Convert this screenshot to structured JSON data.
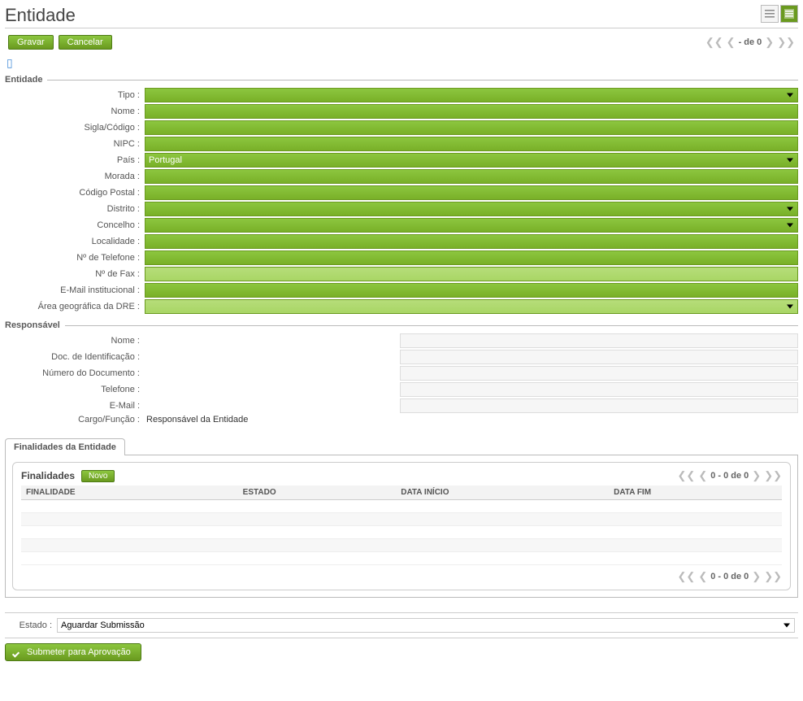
{
  "header": {
    "title": "Entidade"
  },
  "toolbar": {
    "save_label": "Gravar",
    "cancel_label": "Cancelar",
    "pager_text": "- de 0"
  },
  "sections": {
    "entidade": {
      "legend": "Entidade",
      "fields": {
        "tipo": {
          "label": "Tipo :",
          "value": ""
        },
        "nome": {
          "label": "Nome :",
          "value": ""
        },
        "sigla": {
          "label": "Sigla/Código :",
          "value": ""
        },
        "nipc": {
          "label": "NIPC :",
          "value": ""
        },
        "pais": {
          "label": "País :",
          "value": "Portugal"
        },
        "morada": {
          "label": "Morada :",
          "value": ""
        },
        "codigo_postal": {
          "label": "Código Postal :",
          "value": ""
        },
        "distrito": {
          "label": "Distrito :",
          "value": ""
        },
        "concelho": {
          "label": "Concelho :",
          "value": ""
        },
        "localidade": {
          "label": "Localidade :",
          "value": ""
        },
        "telefone": {
          "label": "Nº de Telefone :",
          "value": ""
        },
        "fax": {
          "label": "Nº de Fax :",
          "value": ""
        },
        "email": {
          "label": "E-Mail institucional :",
          "value": ""
        },
        "area_dre": {
          "label": "Área geográfica da DRE :",
          "value": ""
        }
      }
    },
    "responsavel": {
      "legend": "Responsável",
      "fields": {
        "nome": {
          "label": "Nome :"
        },
        "doc_ident": {
          "label": "Doc. de Identificação :"
        },
        "num_doc": {
          "label": "Número do Documento :"
        },
        "telefone": {
          "label": "Telefone :"
        },
        "email": {
          "label": "E-Mail :"
        },
        "cargo": {
          "label": "Cargo/Função :",
          "value": "Responsável da Entidade"
        }
      }
    }
  },
  "tabs": {
    "finalidades": {
      "label": "Finalidades da Entidade"
    }
  },
  "panel": {
    "title": "Finalidades",
    "new_label": "Novo",
    "pager_text": "0 - 0 de 0",
    "columns": {
      "finalidade": "FINALIDADE",
      "estado": "ESTADO",
      "data_inicio": "DATA INÍCIO",
      "data_fim": "DATA FIM"
    }
  },
  "estado": {
    "label": "Estado :",
    "value": "Aguardar Submissão"
  },
  "submit": {
    "label": "Submeter para Aprovação"
  }
}
